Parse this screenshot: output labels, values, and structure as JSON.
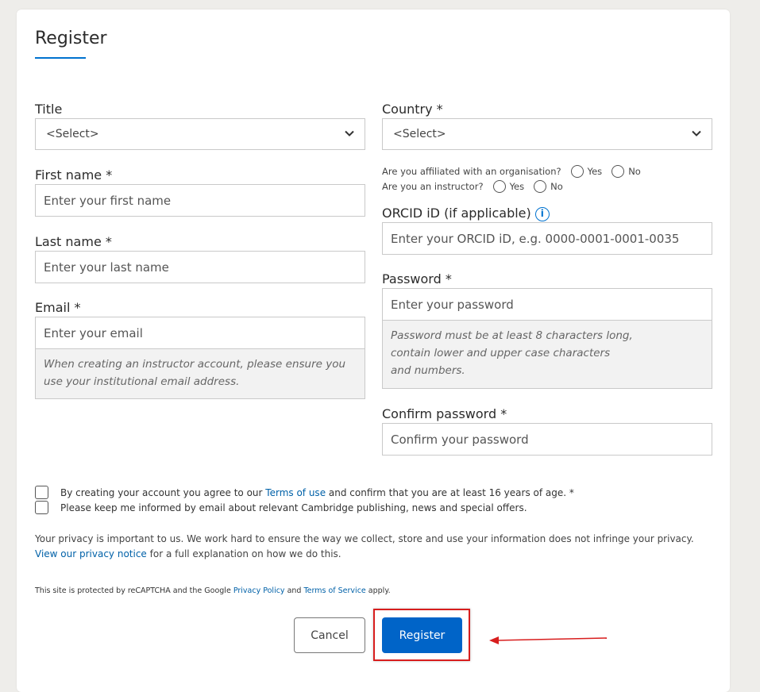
{
  "page": {
    "heading": "Register"
  },
  "form": {
    "title_label": "Title",
    "title_value": "<Select>",
    "country_label": "Country *",
    "country_value": "<Select>",
    "first_name_label": "First name *",
    "first_name_placeholder": "Enter your first name",
    "last_name_label": "Last name *",
    "last_name_placeholder": "Enter your last name",
    "email_label": "Email *",
    "email_placeholder": "Enter your email",
    "email_hint": "When creating an instructor account, please ensure you use your institutional email address.",
    "affiliated_question": "Are you affiliated with an organisation?",
    "instructor_question": "Are you an instructor?",
    "yes_label": "Yes",
    "no_label": "No",
    "orcid_label": "ORCID iD (if applicable)",
    "orcid_info_glyph": "i",
    "orcid_placeholder": "Enter your ORCID iD, e.g. 0000-0001-0001-0035",
    "password_label": "Password *",
    "password_placeholder": "Enter your password",
    "password_hint_line1": "Password must be at least 8 characters long,",
    "password_hint_line2": "contain lower and upper case characters",
    "password_hint_line3": "and numbers.",
    "confirm_password_label": "Confirm password *",
    "confirm_password_placeholder": "Confirm your password"
  },
  "consent": {
    "terms_prefix": "By creating your account you agree to our ",
    "terms_link": "Terms of use",
    "terms_suffix": " and confirm that you are at least 16 years of age. *",
    "newsletter_text": "Please keep me informed by email about relevant Cambridge publishing, news and special offers."
  },
  "privacy": {
    "text": "Your privacy is important to us. We work hard to ensure the way we collect, store and use your information does not infringe your privacy. ",
    "link": "View our privacy notice",
    "suffix": " for a full explanation on how we do this."
  },
  "recaptcha": {
    "prefix": "This site is protected by reCAPTCHA and the Google ",
    "privacy_link": "Privacy Policy",
    "and": " and ",
    "terms_link": "Terms of Service",
    "suffix": " apply."
  },
  "buttons": {
    "cancel": "Cancel",
    "register": "Register"
  },
  "colors": {
    "accent": "#0064c8",
    "link": "#0061a8",
    "highlight": "#d81e1e"
  }
}
